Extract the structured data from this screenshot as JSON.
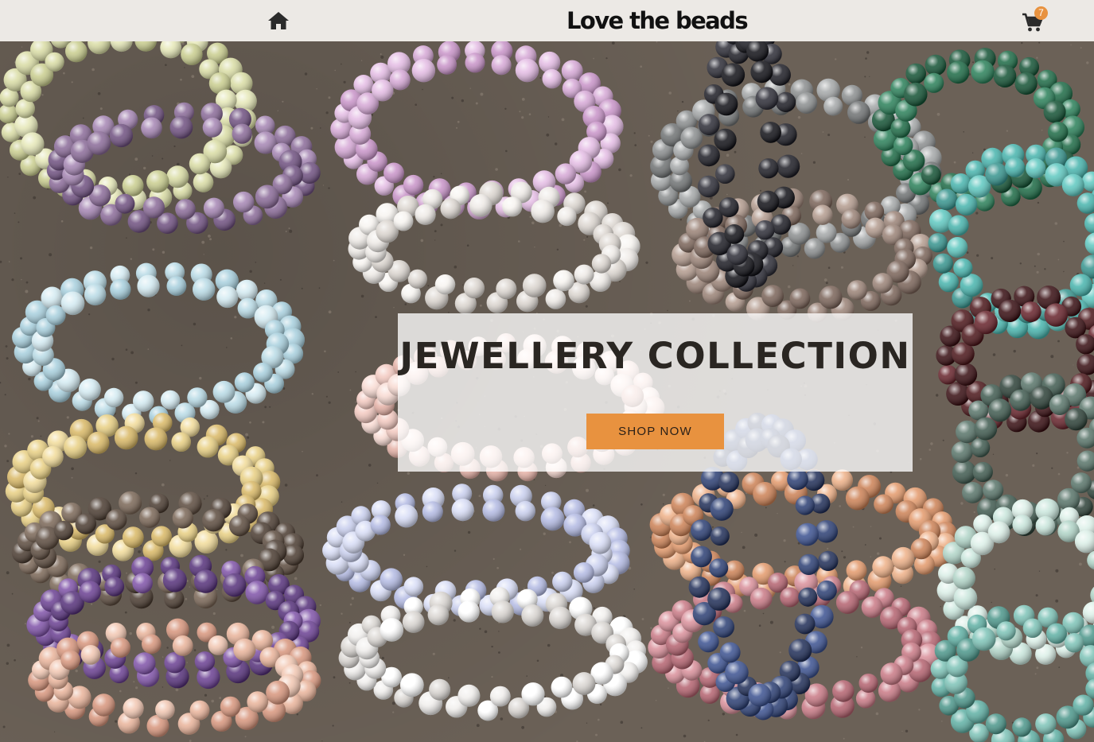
{
  "header": {
    "brand_name": "Love the beads",
    "home_icon": "home-icon",
    "cart_icon": "cart-icon",
    "cart_count": "7"
  },
  "hero": {
    "title": "JEWELLERY COLLECTION",
    "button_label": "SHOP NOW",
    "image": "assorted gemstone bead bracelets on sand"
  },
  "colors": {
    "header_bg": "#ece9e5",
    "accent": "#e8923f",
    "title_text": "#2a2622"
  }
}
